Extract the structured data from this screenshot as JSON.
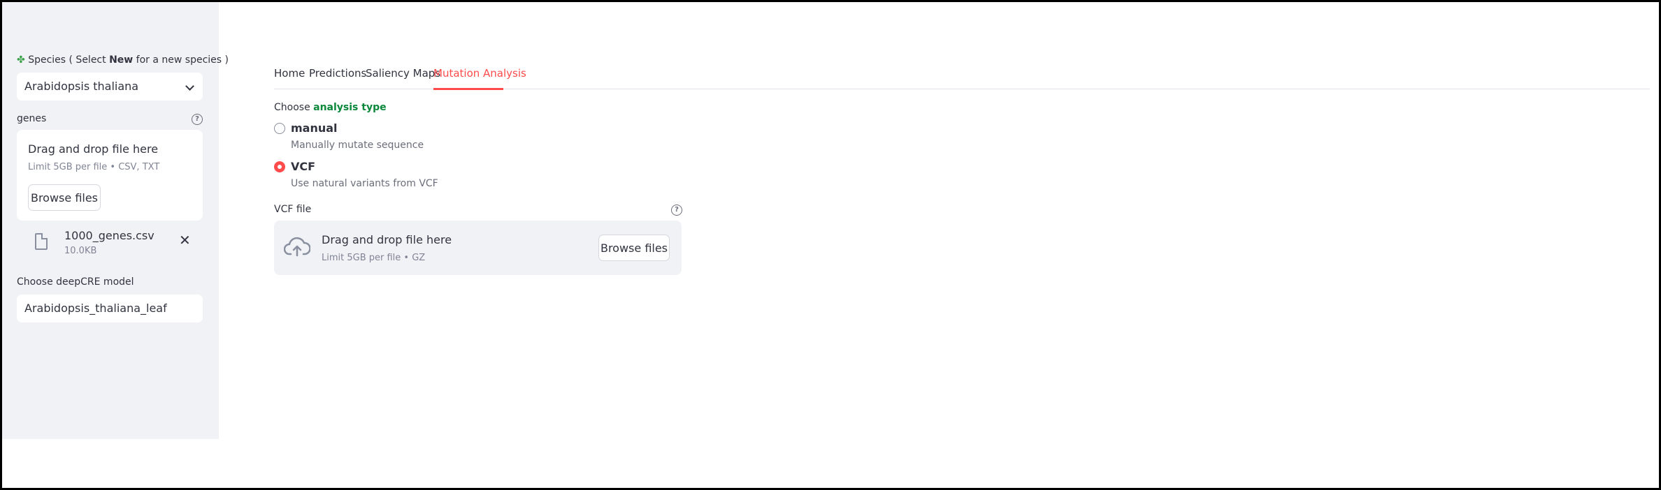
{
  "sidebar": {
    "species_label_prefix": "Species ( Select ",
    "species_label_bold": "New",
    "species_label_suffix": " for a new species )",
    "species_value": "Arabidopsis thaliana",
    "genes_label": "genes",
    "upload": {
      "title": "Drag and drop file here",
      "limit": "Limit 5GB per file • CSV, TXT",
      "browse_label": "Browse files"
    },
    "file": {
      "name": "1000_genes.csv",
      "size": "10.0KB"
    },
    "model_label": "Choose deepCRE model",
    "model_value": "Arabidopsis_thaliana_leaf"
  },
  "tabs": [
    {
      "label": "Home"
    },
    {
      "label": "Predictions"
    },
    {
      "label": "Saliency Maps"
    },
    {
      "label": "Mutation Analysis",
      "active": true
    }
  ],
  "analysis": {
    "label_prefix": "Choose ",
    "label_highlight": "analysis type",
    "options": [
      {
        "label": "manual",
        "caption": "Manually mutate sequence",
        "checked": false
      },
      {
        "label": "VCF",
        "caption": "Use natural variants from VCF",
        "checked": true
      }
    ]
  },
  "vcf": {
    "label": "VCF file",
    "title": "Drag and drop file here",
    "limit": "Limit 5GB per file • GZ",
    "browse_label": "Browse files"
  },
  "colors": {
    "accent": "#ff4b4b",
    "highlight_green": "#09873a",
    "sidebar_bg": "#f0f2f6"
  }
}
